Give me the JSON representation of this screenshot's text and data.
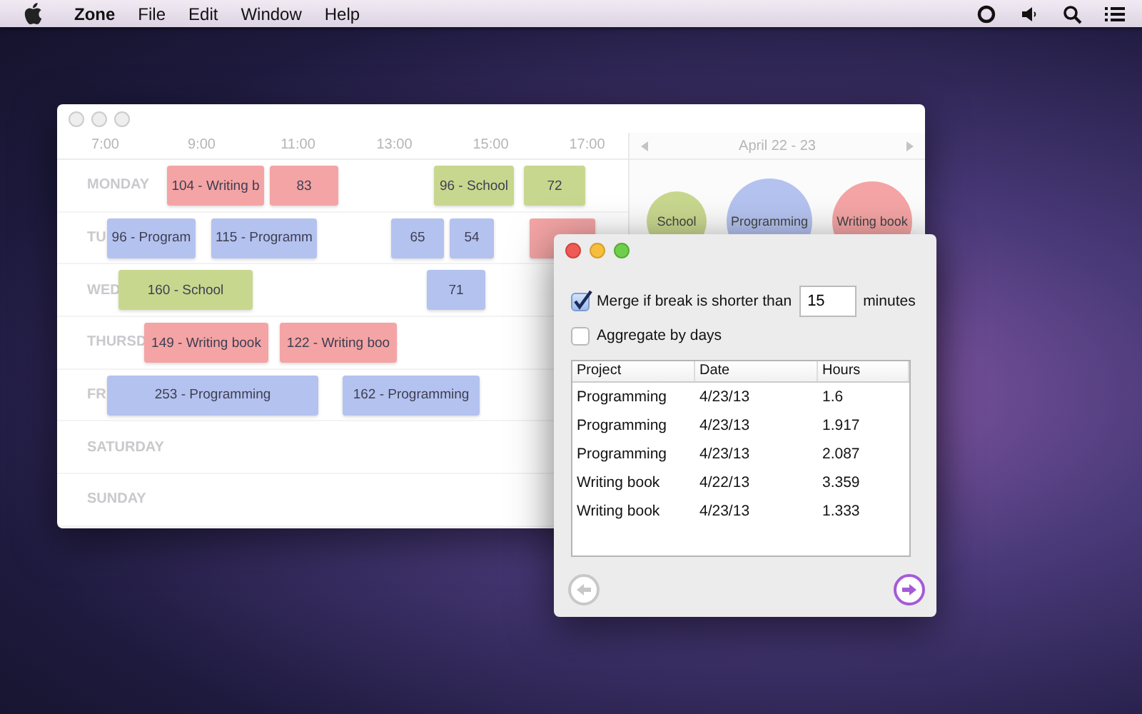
{
  "menu_bar": {
    "app": "Zone",
    "items": [
      "File",
      "Edit",
      "Window",
      "Help"
    ]
  },
  "timeline_window": {
    "times": [
      "7:00",
      "9:00",
      "11:00",
      "13:00",
      "15:00",
      "17:00"
    ],
    "days": [
      {
        "label": "MONDAY",
        "blocks": [
          {
            "text": "104 - Writing b",
            "color": "#f4a4a4"
          },
          {
            "text": "83",
            "color": "#f4a4a4"
          },
          {
            "text": "96 - School",
            "color": "#c8d78e"
          },
          {
            "text": "72",
            "color": "#c8d78e"
          }
        ]
      },
      {
        "label": "TU",
        "blocks": [
          {
            "text": "96 - Program",
            "color": "#b4c2ef"
          },
          {
            "text": "115 - Programm",
            "color": "#b4c2ef"
          },
          {
            "text": "65",
            "color": "#b4c2ef"
          },
          {
            "text": "54",
            "color": "#b4c2ef"
          },
          {
            "color": "#f4a4a4"
          }
        ]
      },
      {
        "label": "WED",
        "blocks": [
          {
            "text": "160 - School",
            "color": "#c8d78e"
          },
          {
            "text": "71",
            "color": "#b4c2ef"
          }
        ]
      },
      {
        "label": "THURSD",
        "blocks": [
          {
            "text": "149 - Writing book",
            "color": "#f4a4a4"
          },
          {
            "text": "122 - Writing boo",
            "color": "#f4a4a4"
          }
        ]
      },
      {
        "label": "FR",
        "blocks": [
          {
            "text": "253 - Programming",
            "color": "#b4c2ef"
          },
          {
            "text": "162 - Programming",
            "color": "#b4c2ef"
          }
        ]
      },
      {
        "label": "SATURDAY"
      },
      {
        "label": "SUNDAY"
      }
    ],
    "range_label": "April 22 - 23",
    "summary": [
      {
        "label": "School",
        "color": "#c8d78e"
      },
      {
        "label": "Programming",
        "color": "#b4c2ef"
      },
      {
        "label": "Writing book",
        "color": "#f4a4a4"
      }
    ]
  },
  "export_dialog": {
    "merge": {
      "checked": true,
      "label": "Merge if break is shorter than",
      "value": "15",
      "unit": "minutes"
    },
    "aggregate": {
      "checked": false,
      "label": "Aggregate by days"
    },
    "table": {
      "columns": [
        "Project",
        "Date",
        "Hours"
      ],
      "rows": [
        [
          "Programming",
          "4/23/13",
          "1.6"
        ],
        [
          "Programming",
          "4/23/13",
          "1.917"
        ],
        [
          "Programming",
          "4/23/13",
          "2.087"
        ],
        [
          "Writing book",
          "4/22/13",
          "3.359"
        ],
        [
          "Writing book",
          "4/23/13",
          "1.333"
        ]
      ]
    },
    "back_button": {
      "disabled": true
    },
    "next_button": {
      "disabled": false
    }
  }
}
